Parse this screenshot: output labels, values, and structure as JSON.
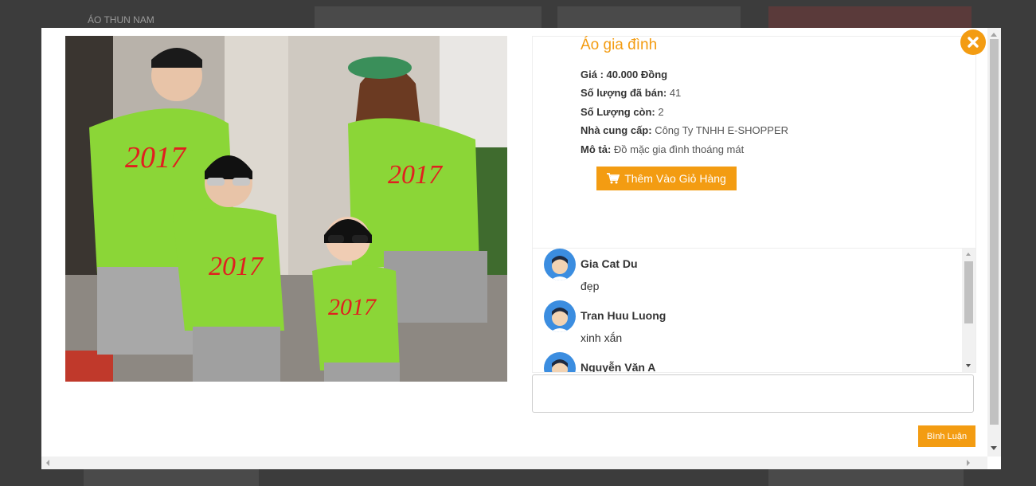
{
  "background": {
    "heading": "ÁO THUN NAM"
  },
  "product": {
    "title": "Áo gia đình",
    "image_alt": "product-photo",
    "price_label": "Giá : 40.000 Đồng",
    "sold_label": "Số lượng đã bán:",
    "sold_value": " 41",
    "remaining_label": "Số Lượng còn:",
    "remaining_value": " 2",
    "supplier_label": "Nhà cung cấp:",
    "supplier_value": " Công Ty TNHH E-SHOPPER",
    "description_label": "Mô tả:",
    "description_value": " Đồ mặc gia đình thoáng mát",
    "add_to_cart_label": "Thêm Vào Giỏ Hàng"
  },
  "comments": [
    {
      "name": "Gia Cat Du",
      "text": "đẹp"
    },
    {
      "name": "Tran Huu Luong",
      "text": "xinh xắn"
    },
    {
      "name": "Nguyễn Văn A",
      "text": ""
    }
  ],
  "comment_form": {
    "placeholder": "",
    "submit_label": "Bình Luận"
  },
  "colors": {
    "accent": "#f39c12",
    "avatar": "#3b8de0",
    "backdrop": "#3c3c3c"
  },
  "icons": {
    "close": "close-icon",
    "cart": "cart-icon"
  }
}
